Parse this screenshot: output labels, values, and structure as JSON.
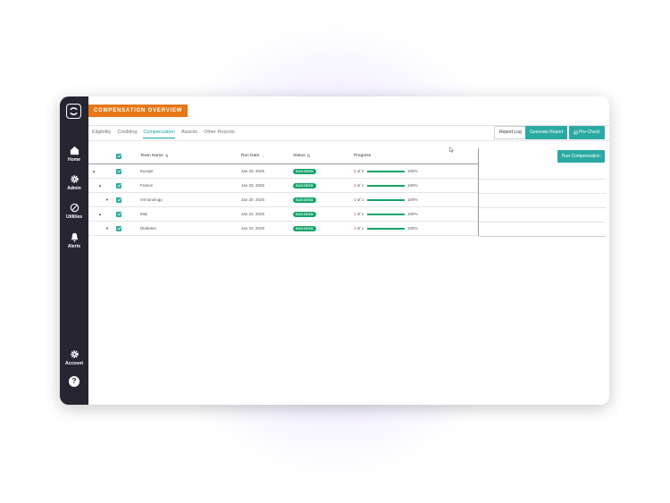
{
  "sidebar": {
    "nav": [
      {
        "label": "Home",
        "icon": "home-icon"
      },
      {
        "label": "Admin",
        "icon": "gear-icon"
      },
      {
        "label": "Utilities",
        "icon": "utilities-icon"
      },
      {
        "label": "Alerts",
        "icon": "bell-icon"
      }
    ],
    "account": {
      "label": "Account",
      "icon": "gear-icon"
    },
    "help": {
      "label": "?",
      "icon": "help-icon"
    }
  },
  "header": {
    "title": "COMPENSATION OVERVIEW"
  },
  "tabs": [
    {
      "label": "Eligibility",
      "active": false
    },
    {
      "label": "Crediting",
      "active": false
    },
    {
      "label": "Compensation",
      "active": true
    },
    {
      "label": "Awards",
      "active": false
    },
    {
      "label": "Other Reports",
      "active": false
    }
  ],
  "toolbar": {
    "report_log": "Report Log",
    "generate_report": "Generate Report",
    "pre_check": "Pre-Check",
    "run_compensation": "Run Compensation"
  },
  "table": {
    "columns": {
      "team_name": "Team Name",
      "run_date": "Run Date",
      "status": "Status",
      "progress": "Progress"
    },
    "rows": [
      {
        "team": "Europe",
        "date": "Jan 20, 2025",
        "status": "SUCCESS",
        "count": "2 of 2",
        "pct": "100%",
        "fill": 1.0,
        "level": 0,
        "chevron": "▲"
      },
      {
        "team": "France",
        "date": "Jan 20, 2025",
        "status": "SUCCESS",
        "count": "1 of 1",
        "pct": "100%",
        "fill": 1.0,
        "level": 1,
        "chevron": "▲"
      },
      {
        "team": "Immunology",
        "date": "Jan 20, 2025",
        "status": "SUCCESS",
        "count": "1 of 1",
        "pct": "100%",
        "fill": 1.0,
        "level": 2,
        "chevron": "▼"
      },
      {
        "team": "Italy",
        "date": "Jan 22, 2025",
        "status": "SUCCESS",
        "count": "1 of 1",
        "pct": "100%",
        "fill": 1.0,
        "level": 1,
        "chevron": "▲"
      },
      {
        "team": "Diabetes",
        "date": "Jan 22, 2025",
        "status": "SUCCESS",
        "count": "1 of 1",
        "pct": "100%",
        "fill": 1.0,
        "level": 2,
        "chevron": "▼"
      }
    ]
  },
  "colors": {
    "accent": "#2aa9a3",
    "brand_orange": "#e67817",
    "success": "#14a36a",
    "sidebar": "#262531"
  }
}
